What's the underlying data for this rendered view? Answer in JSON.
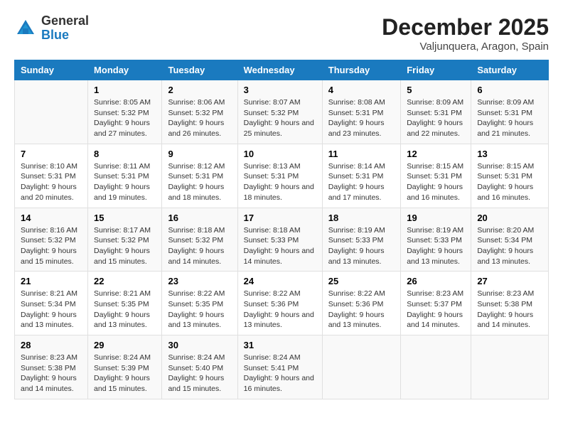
{
  "logo": {
    "text_general": "General",
    "text_blue": "Blue"
  },
  "title": "December 2025",
  "subtitle": "Valjunquera, Aragon, Spain",
  "header_days": [
    "Sunday",
    "Monday",
    "Tuesday",
    "Wednesday",
    "Thursday",
    "Friday",
    "Saturday"
  ],
  "weeks": [
    [
      {
        "day": "",
        "sunrise": "",
        "sunset": "",
        "daylight": ""
      },
      {
        "day": "1",
        "sunrise": "Sunrise: 8:05 AM",
        "sunset": "Sunset: 5:32 PM",
        "daylight": "Daylight: 9 hours and 27 minutes."
      },
      {
        "day": "2",
        "sunrise": "Sunrise: 8:06 AM",
        "sunset": "Sunset: 5:32 PM",
        "daylight": "Daylight: 9 hours and 26 minutes."
      },
      {
        "day": "3",
        "sunrise": "Sunrise: 8:07 AM",
        "sunset": "Sunset: 5:32 PM",
        "daylight": "Daylight: 9 hours and 25 minutes."
      },
      {
        "day": "4",
        "sunrise": "Sunrise: 8:08 AM",
        "sunset": "Sunset: 5:31 PM",
        "daylight": "Daylight: 9 hours and 23 minutes."
      },
      {
        "day": "5",
        "sunrise": "Sunrise: 8:09 AM",
        "sunset": "Sunset: 5:31 PM",
        "daylight": "Daylight: 9 hours and 22 minutes."
      },
      {
        "day": "6",
        "sunrise": "Sunrise: 8:09 AM",
        "sunset": "Sunset: 5:31 PM",
        "daylight": "Daylight: 9 hours and 21 minutes."
      }
    ],
    [
      {
        "day": "7",
        "sunrise": "Sunrise: 8:10 AM",
        "sunset": "Sunset: 5:31 PM",
        "daylight": "Daylight: 9 hours and 20 minutes."
      },
      {
        "day": "8",
        "sunrise": "Sunrise: 8:11 AM",
        "sunset": "Sunset: 5:31 PM",
        "daylight": "Daylight: 9 hours and 19 minutes."
      },
      {
        "day": "9",
        "sunrise": "Sunrise: 8:12 AM",
        "sunset": "Sunset: 5:31 PM",
        "daylight": "Daylight: 9 hours and 18 minutes."
      },
      {
        "day": "10",
        "sunrise": "Sunrise: 8:13 AM",
        "sunset": "Sunset: 5:31 PM",
        "daylight": "Daylight: 9 hours and 18 minutes."
      },
      {
        "day": "11",
        "sunrise": "Sunrise: 8:14 AM",
        "sunset": "Sunset: 5:31 PM",
        "daylight": "Daylight: 9 hours and 17 minutes."
      },
      {
        "day": "12",
        "sunrise": "Sunrise: 8:15 AM",
        "sunset": "Sunset: 5:31 PM",
        "daylight": "Daylight: 9 hours and 16 minutes."
      },
      {
        "day": "13",
        "sunrise": "Sunrise: 8:15 AM",
        "sunset": "Sunset: 5:31 PM",
        "daylight": "Daylight: 9 hours and 16 minutes."
      }
    ],
    [
      {
        "day": "14",
        "sunrise": "Sunrise: 8:16 AM",
        "sunset": "Sunset: 5:32 PM",
        "daylight": "Daylight: 9 hours and 15 minutes."
      },
      {
        "day": "15",
        "sunrise": "Sunrise: 8:17 AM",
        "sunset": "Sunset: 5:32 PM",
        "daylight": "Daylight: 9 hours and 15 minutes."
      },
      {
        "day": "16",
        "sunrise": "Sunrise: 8:18 AM",
        "sunset": "Sunset: 5:32 PM",
        "daylight": "Daylight: 9 hours and 14 minutes."
      },
      {
        "day": "17",
        "sunrise": "Sunrise: 8:18 AM",
        "sunset": "Sunset: 5:33 PM",
        "daylight": "Daylight: 9 hours and 14 minutes."
      },
      {
        "day": "18",
        "sunrise": "Sunrise: 8:19 AM",
        "sunset": "Sunset: 5:33 PM",
        "daylight": "Daylight: 9 hours and 13 minutes."
      },
      {
        "day": "19",
        "sunrise": "Sunrise: 8:19 AM",
        "sunset": "Sunset: 5:33 PM",
        "daylight": "Daylight: 9 hours and 13 minutes."
      },
      {
        "day": "20",
        "sunrise": "Sunrise: 8:20 AM",
        "sunset": "Sunset: 5:34 PM",
        "daylight": "Daylight: 9 hours and 13 minutes."
      }
    ],
    [
      {
        "day": "21",
        "sunrise": "Sunrise: 8:21 AM",
        "sunset": "Sunset: 5:34 PM",
        "daylight": "Daylight: 9 hours and 13 minutes."
      },
      {
        "day": "22",
        "sunrise": "Sunrise: 8:21 AM",
        "sunset": "Sunset: 5:35 PM",
        "daylight": "Daylight: 9 hours and 13 minutes."
      },
      {
        "day": "23",
        "sunrise": "Sunrise: 8:22 AM",
        "sunset": "Sunset: 5:35 PM",
        "daylight": "Daylight: 9 hours and 13 minutes."
      },
      {
        "day": "24",
        "sunrise": "Sunrise: 8:22 AM",
        "sunset": "Sunset: 5:36 PM",
        "daylight": "Daylight: 9 hours and 13 minutes."
      },
      {
        "day": "25",
        "sunrise": "Sunrise: 8:22 AM",
        "sunset": "Sunset: 5:36 PM",
        "daylight": "Daylight: 9 hours and 13 minutes."
      },
      {
        "day": "26",
        "sunrise": "Sunrise: 8:23 AM",
        "sunset": "Sunset: 5:37 PM",
        "daylight": "Daylight: 9 hours and 14 minutes."
      },
      {
        "day": "27",
        "sunrise": "Sunrise: 8:23 AM",
        "sunset": "Sunset: 5:38 PM",
        "daylight": "Daylight: 9 hours and 14 minutes."
      }
    ],
    [
      {
        "day": "28",
        "sunrise": "Sunrise: 8:23 AM",
        "sunset": "Sunset: 5:38 PM",
        "daylight": "Daylight: 9 hours and 14 minutes."
      },
      {
        "day": "29",
        "sunrise": "Sunrise: 8:24 AM",
        "sunset": "Sunset: 5:39 PM",
        "daylight": "Daylight: 9 hours and 15 minutes."
      },
      {
        "day": "30",
        "sunrise": "Sunrise: 8:24 AM",
        "sunset": "Sunset: 5:40 PM",
        "daylight": "Daylight: 9 hours and 15 minutes."
      },
      {
        "day": "31",
        "sunrise": "Sunrise: 8:24 AM",
        "sunset": "Sunset: 5:41 PM",
        "daylight": "Daylight: 9 hours and 16 minutes."
      },
      {
        "day": "",
        "sunrise": "",
        "sunset": "",
        "daylight": ""
      },
      {
        "day": "",
        "sunrise": "",
        "sunset": "",
        "daylight": ""
      },
      {
        "day": "",
        "sunrise": "",
        "sunset": "",
        "daylight": ""
      }
    ]
  ]
}
